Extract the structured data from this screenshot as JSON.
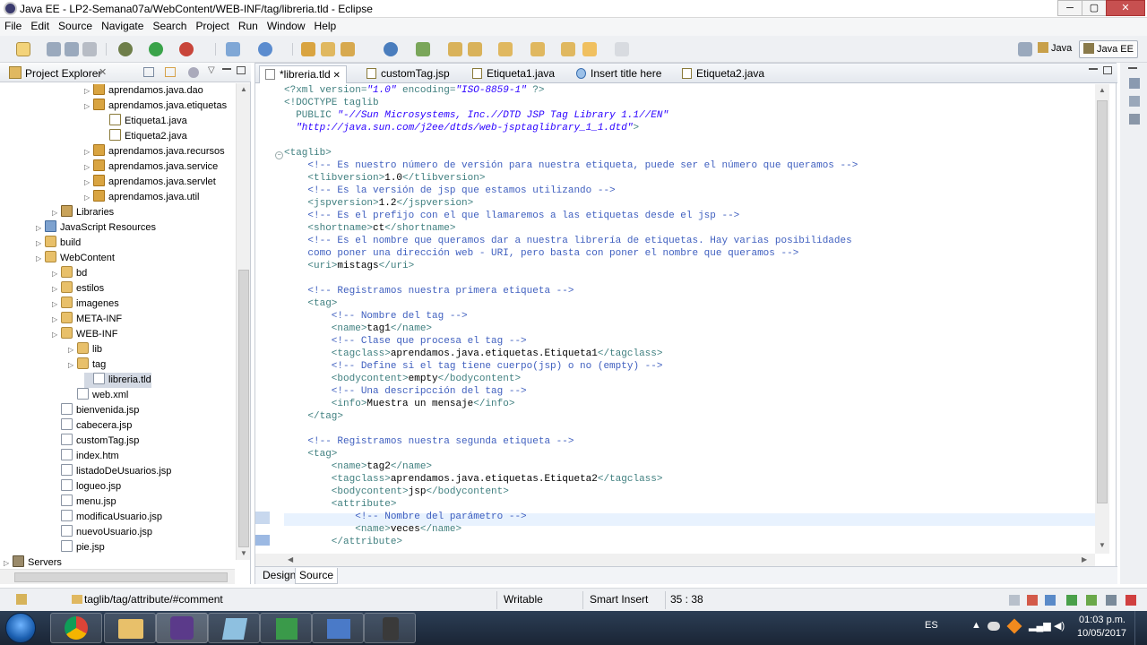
{
  "window": {
    "title": "Java EE - LP2-Semana07a/WebContent/WEB-INF/tag/libreria.tld - Eclipse",
    "minimize": "─",
    "maximize": "▢",
    "close": "✕"
  },
  "menu": [
    "File",
    "Edit",
    "Source",
    "Navigate",
    "Search",
    "Project",
    "Run",
    "Window",
    "Help"
  ],
  "perspectives": {
    "java": "Java",
    "javaee": "Java EE"
  },
  "explorer": {
    "title": "Project Explorer",
    "items": [
      {
        "label": "aprendamos.java.dao",
        "icon": "pkg",
        "indent": 5
      },
      {
        "label": "aprendamos.java.etiquetas",
        "icon": "pkg",
        "indent": 5
      },
      {
        "label": "Etiqueta1.java",
        "icon": "java",
        "indent": 6
      },
      {
        "label": "Etiqueta2.java",
        "icon": "java",
        "indent": 6
      },
      {
        "label": "aprendamos.java.recursos",
        "icon": "pkg",
        "indent": 5
      },
      {
        "label": "aprendamos.java.service",
        "icon": "pkg",
        "indent": 5
      },
      {
        "label": "aprendamos.java.servlet",
        "icon": "pkg",
        "indent": 5
      },
      {
        "label": "aprendamos.java.util",
        "icon": "pkg",
        "indent": 5
      },
      {
        "label": "Libraries",
        "icon": "lib",
        "indent": 3
      },
      {
        "label": "JavaScript Resources",
        "icon": "js",
        "indent": 2
      },
      {
        "label": "build",
        "icon": "folder",
        "indent": 2
      },
      {
        "label": "WebContent",
        "icon": "folder",
        "indent": 2
      },
      {
        "label": "bd",
        "icon": "folder",
        "indent": 3
      },
      {
        "label": "estilos",
        "icon": "folder",
        "indent": 3
      },
      {
        "label": "imagenes",
        "icon": "folder",
        "indent": 3
      },
      {
        "label": "META-INF",
        "icon": "folder",
        "indent": 3
      },
      {
        "label": "WEB-INF",
        "icon": "folder",
        "indent": 3
      },
      {
        "label": "lib",
        "icon": "folder",
        "indent": 4
      },
      {
        "label": "tag",
        "icon": "folder",
        "indent": 4
      },
      {
        "label": "libreria.tld",
        "icon": "file",
        "indent": 5,
        "selected": true
      },
      {
        "label": "web.xml",
        "icon": "file",
        "indent": 4
      },
      {
        "label": "bienvenida.jsp",
        "icon": "file",
        "indent": 3
      },
      {
        "label": "cabecera.jsp",
        "icon": "file",
        "indent": 3
      },
      {
        "label": "customTag.jsp",
        "icon": "file",
        "indent": 3
      },
      {
        "label": "index.htm",
        "icon": "file",
        "indent": 3
      },
      {
        "label": "listadoDeUsuarios.jsp",
        "icon": "file",
        "indent": 3
      },
      {
        "label": "logueo.jsp",
        "icon": "file",
        "indent": 3
      },
      {
        "label": "menu.jsp",
        "icon": "file",
        "indent": 3
      },
      {
        "label": "modificaUsuario.jsp",
        "icon": "file",
        "indent": 3
      },
      {
        "label": "nuevoUsuario.jsp",
        "icon": "file",
        "indent": 3
      },
      {
        "label": "pie.jsp",
        "icon": "file",
        "indent": 3
      },
      {
        "label": "Servers",
        "icon": "server",
        "indent": 0
      }
    ]
  },
  "tabs": [
    {
      "label": "*libreria.tld",
      "icon": "tld",
      "active": true
    },
    {
      "label": "customTag.jsp",
      "icon": "java"
    },
    {
      "label": "Etiqueta1.java",
      "icon": "java"
    },
    {
      "label": "Insert title here",
      "icon": "web"
    },
    {
      "label": "Etiqueta2.java",
      "icon": "java"
    }
  ],
  "code": [
    [
      [
        "dt",
        "<?xml version="
      ],
      [
        "str",
        "\"1.0\""
      ],
      [
        "dt",
        " encoding="
      ],
      [
        "str",
        "\"ISO-8859-1\""
      ],
      [
        "dt",
        " ?>"
      ]
    ],
    [
      [
        "dt",
        "<!DOCTYPE taglib"
      ]
    ],
    [
      [
        "dt",
        "  PUBLIC "
      ],
      [
        "str",
        "\"-//Sun Microsystems, Inc.//DTD JSP Tag Library 1.1//EN\""
      ]
    ],
    [
      [
        "str",
        "  \"http://java.sun.com/j2ee/dtds/web-jsptaglibrary_1_1.dtd\""
      ],
      [
        "dt",
        ">"
      ]
    ],
    [
      [
        "txt",
        ""
      ]
    ],
    [
      [
        "tagc",
        "<taglib>"
      ]
    ],
    [
      [
        "cmt",
        "    <!-- Es nuestro número de versión para nuestra etiqueta, puede ser el número que queramos -->"
      ]
    ],
    [
      [
        "tagc",
        "    <tlibversion>"
      ],
      [
        "txt",
        "1.0"
      ],
      [
        "tagc",
        "</tlibversion>"
      ]
    ],
    [
      [
        "cmt",
        "    <!-- Es la versión de jsp que estamos utilizando -->"
      ]
    ],
    [
      [
        "tagc",
        "    <jspversion>"
      ],
      [
        "txt",
        "1.2"
      ],
      [
        "tagc",
        "</jspversion>"
      ]
    ],
    [
      [
        "cmt",
        "    <!-- Es el prefijo con el que llamaremos a las etiquetas desde el jsp -->"
      ]
    ],
    [
      [
        "tagc",
        "    <shortname>"
      ],
      [
        "txt",
        "ct"
      ],
      [
        "tagc",
        "</shortname>"
      ]
    ],
    [
      [
        "cmt",
        "    <!-- Es el nombre que queramos dar a nuestra librería de etiquetas. Hay varias posibilidades"
      ]
    ],
    [
      [
        "cmt",
        "    como poner una dirección web - URI, pero basta con poner el nombre que queramos -->"
      ]
    ],
    [
      [
        "tagc",
        "    <uri>"
      ],
      [
        "txt",
        "mistags"
      ],
      [
        "tagc",
        "</uri>"
      ]
    ],
    [
      [
        "txt",
        ""
      ]
    ],
    [
      [
        "cmt",
        "    <!-- Registramos nuestra primera etiqueta -->"
      ]
    ],
    [
      [
        "tagc",
        "    <tag>"
      ]
    ],
    [
      [
        "cmt",
        "        <!-- Nombre del tag -->"
      ]
    ],
    [
      [
        "tagc",
        "        <name>"
      ],
      [
        "txt",
        "tag1"
      ],
      [
        "tagc",
        "</name>"
      ]
    ],
    [
      [
        "cmt",
        "        <!-- Clase que procesa el tag -->"
      ]
    ],
    [
      [
        "tagc",
        "        <tagclass>"
      ],
      [
        "txt",
        "aprendamos.java.etiquetas.Etiqueta1"
      ],
      [
        "tagc",
        "</tagclass>"
      ]
    ],
    [
      [
        "cmt",
        "        <!-- Define si el tag tiene cuerpo(jsp) o no (empty) -->"
      ]
    ],
    [
      [
        "tagc",
        "        <bodycontent>"
      ],
      [
        "txt",
        "empty"
      ],
      [
        "tagc",
        "</bodycontent>"
      ]
    ],
    [
      [
        "cmt",
        "        <!-- Una descripcción del tag -->"
      ]
    ],
    [
      [
        "tagc",
        "        <info>"
      ],
      [
        "txt",
        "Muestra un mensaje"
      ],
      [
        "tagc",
        "</info>"
      ]
    ],
    [
      [
        "tagc",
        "    </tag>"
      ]
    ],
    [
      [
        "txt",
        ""
      ]
    ],
    [
      [
        "cmt",
        "    <!-- Registramos nuestra segunda etiqueta -->"
      ]
    ],
    [
      [
        "tagc",
        "    <tag>"
      ]
    ],
    [
      [
        "tagc",
        "        <name>"
      ],
      [
        "txt",
        "tag2"
      ],
      [
        "tagc",
        "</name>"
      ]
    ],
    [
      [
        "tagc",
        "        <tagclass>"
      ],
      [
        "txt",
        "aprendamos.java.etiquetas.Etiqueta2"
      ],
      [
        "tagc",
        "</tagclass>"
      ]
    ],
    [
      [
        "tagc",
        "        <bodycontent>"
      ],
      [
        "txt",
        "jsp"
      ],
      [
        "tagc",
        "</bodycontent>"
      ]
    ],
    [
      [
        "tagc",
        "        <attribute>"
      ]
    ],
    [
      [
        "cmt",
        "            <!-- Nombre del parámetro -->"
      ]
    ],
    [
      [
        "tagc",
        "            <name>"
      ],
      [
        "txt",
        "veces"
      ],
      [
        "tagc",
        "</name>"
      ]
    ],
    [
      [
        "tagc",
        "        </attribute>"
      ]
    ]
  ],
  "bottom_tabs": [
    "Design",
    "Source"
  ],
  "status": {
    "path": "taglib/tag/attribute/#comment",
    "mode": "Writable",
    "insert": "Smart Insert",
    "position": "35 : 38"
  },
  "taskbar": {
    "lang": "ES",
    "time": "01:03 p.m.",
    "date": "10/05/2017"
  }
}
